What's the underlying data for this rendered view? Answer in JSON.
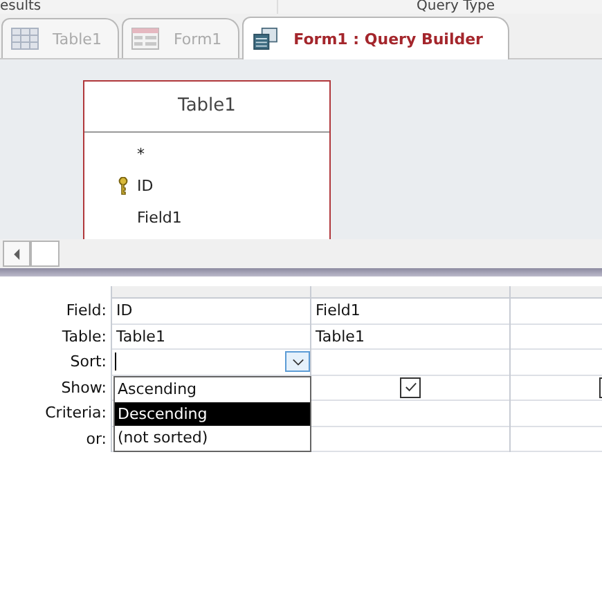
{
  "ribbon": {
    "left_label": "esults",
    "right_label": "Query Type"
  },
  "tabs": [
    {
      "label": "Table1",
      "kind": "table",
      "selected": false
    },
    {
      "label": "Form1",
      "kind": "form",
      "selected": false
    },
    {
      "label": "Form1 : Query Builder",
      "kind": "query",
      "selected": true
    }
  ],
  "table_box": {
    "title": "Table1",
    "fields": [
      {
        "name": "*",
        "primary_key": false
      },
      {
        "name": "ID",
        "primary_key": true
      },
      {
        "name": "Field1",
        "primary_key": false
      }
    ]
  },
  "grid": {
    "row_labels": [
      "Field:",
      "Table:",
      "Sort:",
      "Show:",
      "Criteria:",
      "or:"
    ],
    "columns": [
      {
        "field": "ID",
        "table": "Table1",
        "sort_open": true
      },
      {
        "field": "Field1",
        "table": "Table1",
        "show": true
      },
      {
        "has_checkbox": true
      }
    ],
    "sort_options": [
      {
        "label": "Ascending",
        "selected": false
      },
      {
        "label": "Descending",
        "selected": true
      },
      {
        "label": "(not sorted)",
        "selected": false
      }
    ]
  }
}
